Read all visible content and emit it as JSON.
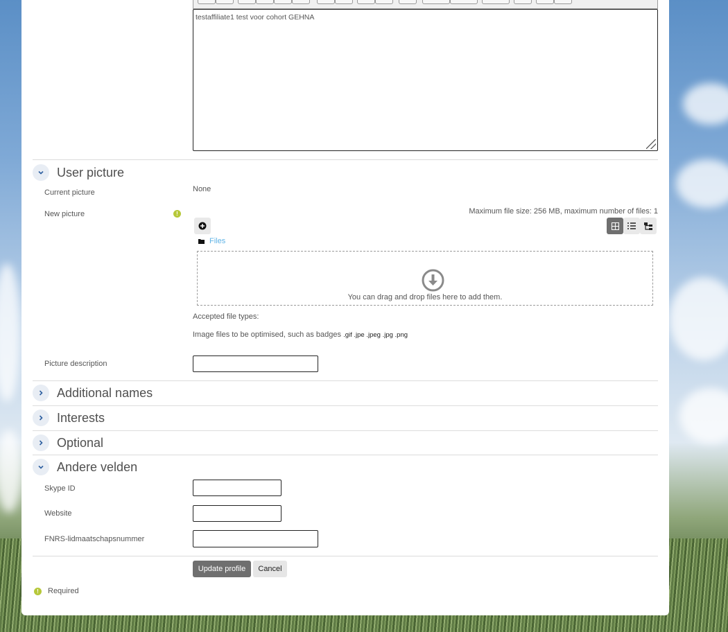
{
  "editor": {
    "content": "testaffiliate1 test voor cohort GEHNA"
  },
  "sections": {
    "user_picture": {
      "title": "User picture",
      "current_picture_label": "Current picture",
      "current_picture_value": "None",
      "new_picture_label": "New picture",
      "max_size_text": "Maximum file size: 256 MB, maximum number of files: 1",
      "files_label": "Files",
      "dropzone_text": "You can drag and drop files here to add them.",
      "accepted_label": "Accepted file types:",
      "accepted_desc": "Image files to be optimised, such as badges",
      "accepted_ext": ".gif .jpe .jpeg .jpg .png",
      "picture_desc_label": "Picture description",
      "picture_desc_value": ""
    },
    "additional_names": {
      "title": "Additional names"
    },
    "interests": {
      "title": "Interests"
    },
    "optional": {
      "title": "Optional"
    },
    "andere_velden": {
      "title": "Andere velden",
      "skype_label": "Skype ID",
      "website_label": "Website",
      "fnrs_label": "FNRS-lidmaatschapsnummer"
    }
  },
  "actions": {
    "update_label": "Update profile",
    "cancel_label": "Cancel"
  },
  "required_note": "Required",
  "colors": {
    "accent": "#2d5fa0",
    "link": "#5fb3e6",
    "required": "#b6c83a",
    "primary_btn": "#6f6f6f"
  }
}
